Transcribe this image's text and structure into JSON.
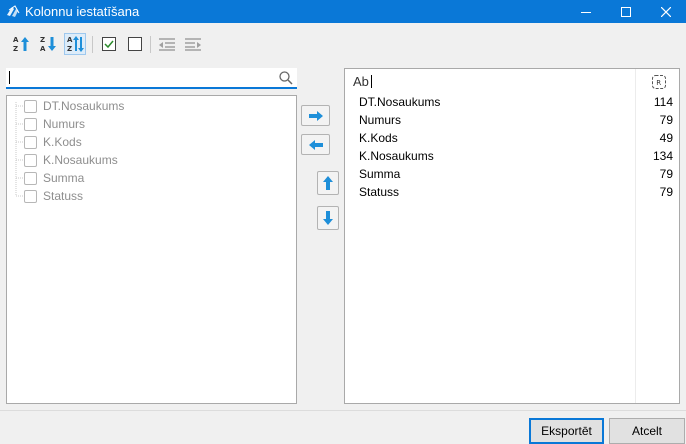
{
  "window": {
    "title": "Kolonnu iestatīšana",
    "controls": [
      "minimize-icon",
      "maximize-icon",
      "close-icon"
    ]
  },
  "toolbar": {
    "buttons": [
      {
        "name": "sort-ascending-icon",
        "active": false
      },
      {
        "name": "sort-descending-icon",
        "active": false
      },
      {
        "name": "sort-toggle-icon",
        "active": true
      },
      {
        "name": "check-all-icon",
        "active": false
      },
      {
        "name": "uncheck-all-icon",
        "active": false
      },
      {
        "name": "collapse-list-icon",
        "active": false
      },
      {
        "name": "expand-list-icon",
        "active": false
      }
    ]
  },
  "search": {
    "value": "",
    "placeholder": ""
  },
  "available_columns": [
    {
      "label": "DT.Nosaukums",
      "checked": false
    },
    {
      "label": "Numurs",
      "checked": false
    },
    {
      "label": "K.Kods",
      "checked": false
    },
    {
      "label": "K.Nosaukums",
      "checked": false
    },
    {
      "label": "Summa",
      "checked": false
    },
    {
      "label": "Statuss",
      "checked": false
    }
  ],
  "selected_columns": {
    "header_text": "Ab",
    "rows": [
      {
        "name": "DT.Nosaukums",
        "width": "114"
      },
      {
        "name": "Numurs",
        "width": "79"
      },
      {
        "name": "K.Kods",
        "width": "49"
      },
      {
        "name": "K.Nosaukums",
        "width": "134"
      },
      {
        "name": "Summa",
        "width": "79"
      },
      {
        "name": "Statuss",
        "width": "79"
      }
    ]
  },
  "buttons": {
    "export_label": "Eksportēt",
    "cancel_label": "Atcelt"
  },
  "colors": {
    "accent": "#0a78d7",
    "arrow": "#1e8fd9"
  }
}
